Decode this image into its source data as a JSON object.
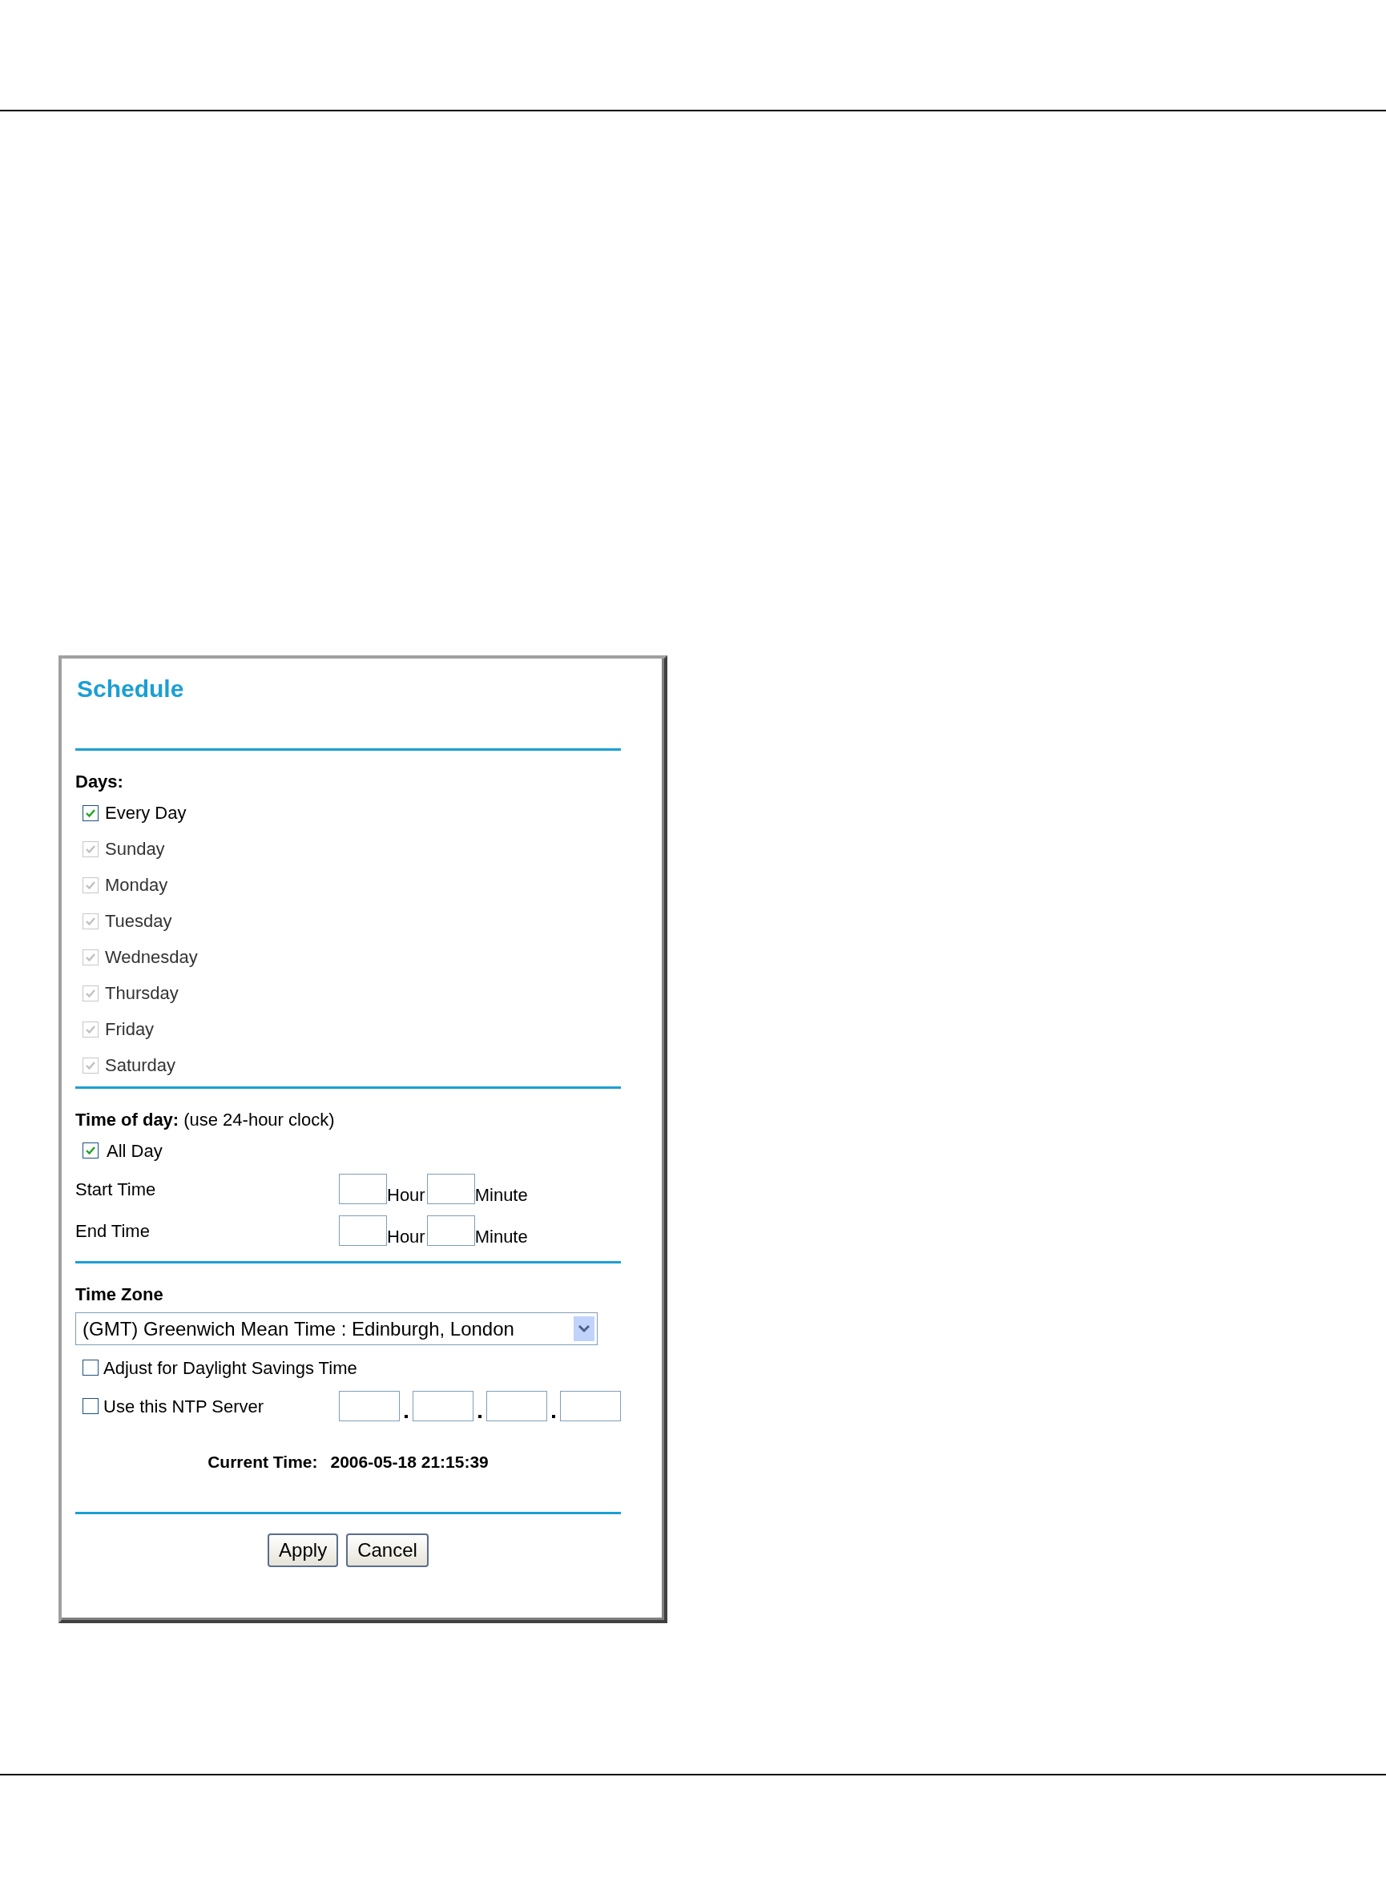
{
  "title": "Schedule",
  "days": {
    "label": "Days:",
    "items": [
      {
        "label": "Every Day",
        "checked": true,
        "disabled": false
      },
      {
        "label": "Sunday",
        "checked": true,
        "disabled": true
      },
      {
        "label": "Monday",
        "checked": true,
        "disabled": true
      },
      {
        "label": "Tuesday",
        "checked": true,
        "disabled": true
      },
      {
        "label": "Wednesday",
        "checked": true,
        "disabled": true
      },
      {
        "label": "Thursday",
        "checked": true,
        "disabled": true
      },
      {
        "label": "Friday",
        "checked": true,
        "disabled": true
      },
      {
        "label": "Saturday",
        "checked": true,
        "disabled": true
      }
    ]
  },
  "time_of_day": {
    "label": "Time of day:",
    "hint": "(use 24-hour clock)",
    "all_day": {
      "label": "All Day",
      "checked": true
    },
    "rows": [
      {
        "label": "Start Time",
        "hour_label": "Hour",
        "minute_label": "Minute"
      },
      {
        "label": "End Time",
        "hour_label": "Hour",
        "minute_label": "Minute"
      }
    ]
  },
  "time_zone": {
    "label": "Time Zone",
    "value": "(GMT) Greenwich Mean Time : Edinburgh, London",
    "daylight": {
      "label": "Adjust for Daylight Savings Time",
      "checked": false
    },
    "ntp": {
      "label": "Use this NTP Server",
      "checked": false
    }
  },
  "current_time": {
    "label": "Current Time:",
    "value": "2006-05-18 21:15:39"
  },
  "buttons": [
    "Apply",
    "Cancel"
  ]
}
